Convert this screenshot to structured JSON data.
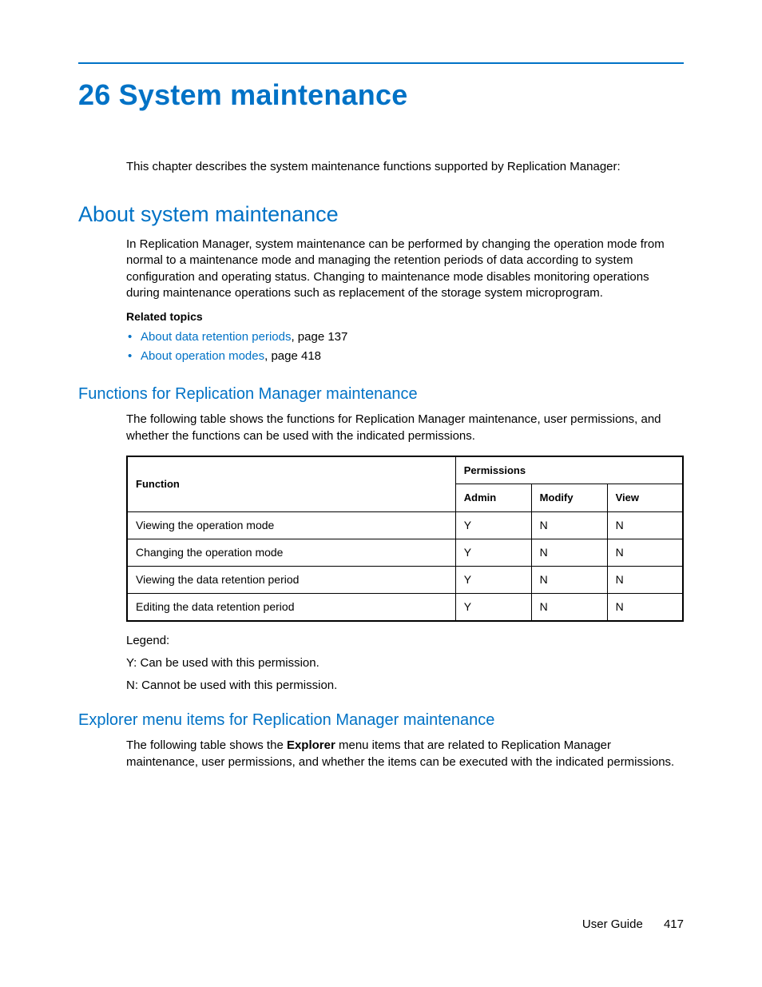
{
  "chapter": {
    "number": "26",
    "title": "System maintenance"
  },
  "intro": "This chapter describes the system maintenance functions supported by Replication Manager:",
  "section1": {
    "title": "About system maintenance",
    "para": "In Replication Manager, system maintenance can be performed by changing the operation mode from normal to a maintenance mode and managing the retention periods of data according to system configuration and operating status. Changing to maintenance mode disables monitoring operations during maintenance operations such as replacement of the storage system microprogram.",
    "related_heading": "Related topics",
    "related": [
      {
        "link": "About data retention periods",
        "suffix": ", page 137"
      },
      {
        "link": "About operation modes",
        "suffix": ", page 418"
      }
    ]
  },
  "section2": {
    "title": "Functions for Replication Manager maintenance",
    "para": "The following table shows the functions for Replication Manager maintenance, user permissions, and whether the functions can be used with the indicated permissions.",
    "table": {
      "head": {
        "function": "Function",
        "permissions": "Permissions",
        "admin": "Admin",
        "modify": "Modify",
        "view": "View"
      },
      "rows": [
        {
          "fn": "Viewing the operation mode",
          "admin": "Y",
          "modify": "N",
          "view": "N"
        },
        {
          "fn": "Changing the operation mode",
          "admin": "Y",
          "modify": "N",
          "view": "N"
        },
        {
          "fn": "Viewing the data retention period",
          "admin": "Y",
          "modify": "N",
          "view": "N"
        },
        {
          "fn": "Editing the data retention period",
          "admin": "Y",
          "modify": "N",
          "view": "N"
        }
      ]
    },
    "legend": {
      "title": "Legend:",
      "y": "Y: Can be used with this permission.",
      "n": "N: Cannot be used with this permission."
    }
  },
  "section3": {
    "title": "Explorer menu items for Replication Manager maintenance",
    "para_pre": "The following table shows the ",
    "para_bold": "Explorer",
    "para_post": " menu items that are related to Replication Manager maintenance, user permissions, and whether the items can be executed with the indicated permissions."
  },
  "footer": {
    "label": "User Guide",
    "page": "417"
  }
}
